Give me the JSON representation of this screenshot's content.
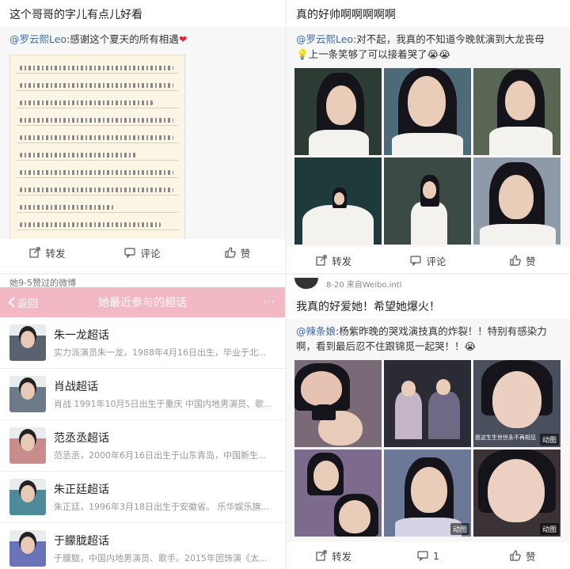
{
  "top_left": {
    "post_title": "这个哥哥的字儿有点儿好看",
    "repost_mention": "@罗云熙Leo",
    "repost_text": ":感谢这个夏天的所有相遇",
    "heart": "❤",
    "actions": {
      "repost": "转发",
      "comment": "评论",
      "like": "赞"
    }
  },
  "top_right": {
    "post_title": "真的好帅啊啊啊啊啊",
    "repost_mention": "@罗云熙Leo",
    "repost_text_1": ":对不起，我真的不知道今晚就演到大龙丧母",
    "repost_text_2": "上一条笑够了可以接着哭了",
    "emoji": "😭😭",
    "actions": {
      "repost": "转发",
      "comment": "评论",
      "like": "赞"
    }
  },
  "bottom_left": {
    "top_text": "她9-5赞过的微博",
    "header": {
      "back": "返回",
      "title": "她最近参与的超话",
      "more": "···"
    },
    "topics": [
      {
        "name": "朱一龙超话",
        "desc": "实力派演员朱一龙，1988年4月16日出生，毕业于北...",
        "color": "#5a6270"
      },
      {
        "name": "肖战超话",
        "desc": "肖战 1991年10月5日出生于重庆 中国内地男演员、歌...",
        "color": "#6c7a8a"
      },
      {
        "name": "范丞丞超话",
        "desc": "范丞丞，2000年6月16日出生于山东青岛，中国新生...",
        "color": "#c98c8c"
      },
      {
        "name": "朱正廷超话",
        "desc": "朱正廷，1996年3月18日出生于安徽省。 乐华娱乐旗...",
        "color": "#4f8a9a"
      },
      {
        "name": "于朦胧超话",
        "desc": "于朦胧，中国内地男演员、歌手。2015年因饰演《太...",
        "color": "#6a72b8"
      }
    ]
  },
  "bottom_right": {
    "meta": "8-20 来自Weibo.intl",
    "post_title": "我真的好爱她！希望她爆火！",
    "repost_mention": "@辣条娘",
    "repost_text": ":杨紫昨晚的哭戏演技真的炸裂！！特别有感染力啊，看到最后忍不住跟锦觅一起哭！！",
    "emoji": "😭",
    "badge": "动图",
    "subtitle": "愿这生生世世永不再相见",
    "actions": {
      "repost": "转发",
      "comment": "1",
      "like": "赞"
    }
  },
  "colors": {
    "accent_blue": "#3c6aa5",
    "header_pink": "#f2b9c5"
  }
}
